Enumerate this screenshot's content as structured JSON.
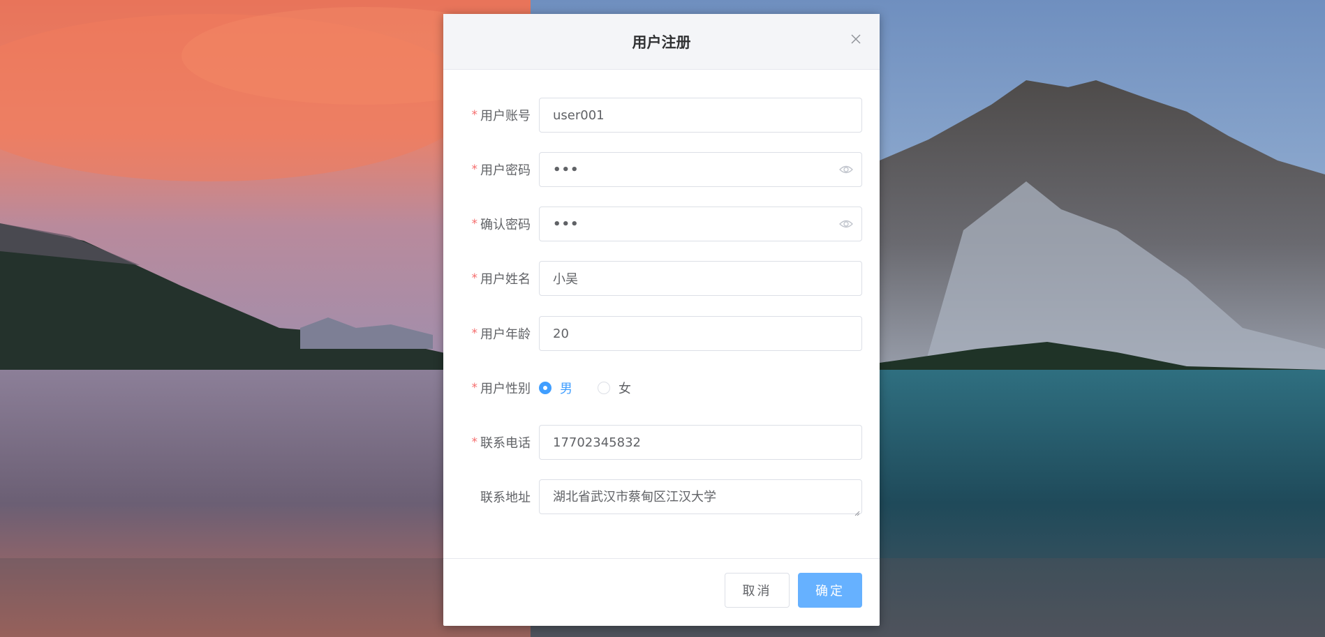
{
  "dialog": {
    "title": "用户注册",
    "close_icon": "close-icon"
  },
  "form": {
    "account": {
      "label": "用户账号",
      "value": "user001",
      "required": true
    },
    "password": {
      "label": "用户密码",
      "value": "•••",
      "required": true,
      "icon": "eye-icon"
    },
    "confirm_password": {
      "label": "确认密码",
      "value": "•••",
      "required": true,
      "icon": "eye-icon"
    },
    "name": {
      "label": "用户姓名",
      "value": "小吴",
      "required": true
    },
    "age": {
      "label": "用户年龄",
      "value": "20",
      "required": true
    },
    "gender": {
      "label": "用户性别",
      "required": true,
      "options": [
        "男",
        "女"
      ],
      "selected": "男"
    },
    "phone": {
      "label": "联系电话",
      "value": "17702345832",
      "required": true
    },
    "address": {
      "label": "联系地址",
      "value": "湖北省武汉市蔡甸区江汉大学",
      "required": false
    }
  },
  "required_mark": "*",
  "footer": {
    "cancel_label": "取消",
    "confirm_label": "确定"
  },
  "colors": {
    "primary": "#409eff",
    "primary_light": "#66b1ff",
    "required": "#f56c6c",
    "header_bg": "#f4f5f8"
  }
}
